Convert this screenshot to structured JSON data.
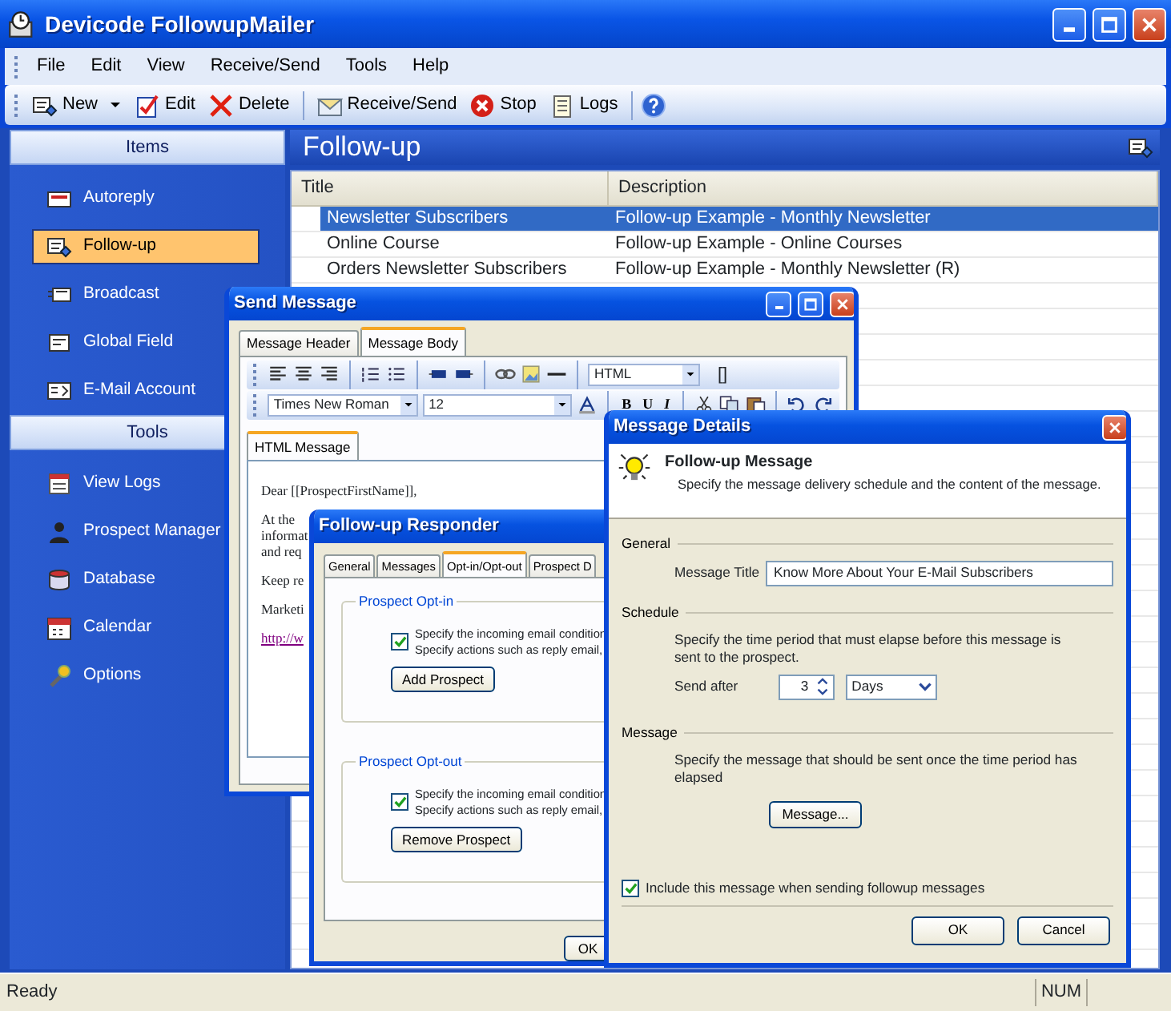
{
  "window": {
    "title": "Devicode FollowupMailer"
  },
  "menu": [
    "File",
    "Edit",
    "View",
    "Receive/Send",
    "Tools",
    "Help"
  ],
  "toolbar": [
    {
      "kind": "dropdown",
      "label": "New"
    },
    {
      "kind": "button",
      "label": "Edit"
    },
    {
      "kind": "button",
      "label": "Delete"
    },
    {
      "kind": "separator"
    },
    {
      "kind": "button",
      "label": "Receive/Send"
    },
    {
      "kind": "button",
      "label": "Stop"
    },
    {
      "kind": "button",
      "label": "Logs"
    },
    {
      "kind": "separator"
    },
    {
      "kind": "icon"
    }
  ],
  "sidebar": {
    "sections": [
      {
        "title": "Items",
        "items": [
          {
            "label": "Autoreply",
            "selected": false
          },
          {
            "label": "Follow-up",
            "selected": true
          },
          {
            "label": "Broadcast",
            "selected": false
          },
          {
            "label": "Global Field",
            "selected": false
          },
          {
            "label": "E-Mail Account",
            "selected": false
          }
        ]
      },
      {
        "title": "Tools",
        "items": [
          {
            "label": "View Logs",
            "selected": false
          },
          {
            "label": "Prospect Manager",
            "selected": false
          },
          {
            "label": "Database",
            "selected": false
          },
          {
            "label": "Calendar",
            "selected": false
          },
          {
            "label": "Options",
            "selected": false
          }
        ]
      }
    ]
  },
  "content": {
    "title": "Follow-up",
    "table": {
      "columns": [
        "Title",
        "Description"
      ],
      "rows": [
        {
          "cells": [
            "Newsletter Subscribers",
            "Follow-up Example - Monthly Newsletter"
          ],
          "selected": true
        },
        {
          "cells": [
            "Online Course",
            "Follow-up Example - Online Courses"
          ],
          "selected": false
        },
        {
          "cells": [
            "Orders Newsletter Subscribers",
            "Follow-up Example - Monthly Newsletter (R)"
          ],
          "selected": false
        }
      ]
    }
  },
  "status_bar": {
    "text": "Ready",
    "panels": [
      "NUM"
    ]
  },
  "send_message": {
    "title": "Send Message",
    "tabs": [
      {
        "label": "Message Header",
        "selected": false
      },
      {
        "label": "Message Body",
        "selected": true
      }
    ],
    "format": "HTML",
    "brackets": "[]",
    "font": "Times New Roman",
    "size": "12",
    "format_buttons": [
      "B",
      "U",
      "I"
    ],
    "editor_tabs": [
      {
        "label": "HTML Message",
        "selected": true
      }
    ],
    "body": [
      {
        "kind": "text",
        "lines": [
          "Dear [[ProspectFirstName]],"
        ]
      },
      {
        "kind": "text",
        "lines": [
          "At the",
          "informat",
          "and req"
        ]
      },
      {
        "kind": "text",
        "lines": [
          "Keep re"
        ]
      },
      {
        "kind": "text",
        "lines": [
          "Marketi"
        ]
      },
      {
        "kind": "link",
        "lines": [
          "http://w"
        ]
      }
    ]
  },
  "follow_up_responder": {
    "title": "Follow-up Responder",
    "tabs": [
      {
        "label": "General",
        "selected": false
      },
      {
        "label": "Messages",
        "selected": false
      },
      {
        "label": "Opt-in/Opt-out",
        "selected": true
      },
      {
        "label": "Prospect D",
        "selected": false
      }
    ],
    "groups": [
      {
        "title": "Prospect Opt-in",
        "checked": true,
        "lines": [
          "Specify the incoming email condition",
          "Specify actions such as reply email,"
        ],
        "button": "Add Prospect"
      },
      {
        "title": "Prospect Opt-out",
        "checked": true,
        "lines": [
          "Specify the incoming email condition",
          "Specify actions such as reply email,"
        ],
        "button": "Remove Prospect"
      }
    ],
    "buttons": [
      "OK"
    ]
  },
  "message_details": {
    "title": "Message Details",
    "heading": "Follow-up Message",
    "subheading": "Specify the message delivery schedule and the content of the message.",
    "general": {
      "label": "General",
      "field_label": "Message Title",
      "field_value": "Know More About Your E-Mail Subscribers"
    },
    "schedule": {
      "label": "Schedule",
      "text": "Specify the time period that must elapse before this message is sent to the prospect.",
      "send_after_label": "Send after",
      "amount": "3",
      "unit": "Days"
    },
    "message": {
      "label": "Message",
      "text": "Specify the message that should be sent once the time period has elapsed",
      "button": "Message..."
    },
    "include": {
      "label": "Include this message when sending followup messages",
      "checked": true
    },
    "buttons": [
      "OK",
      "Cancel"
    ]
  }
}
